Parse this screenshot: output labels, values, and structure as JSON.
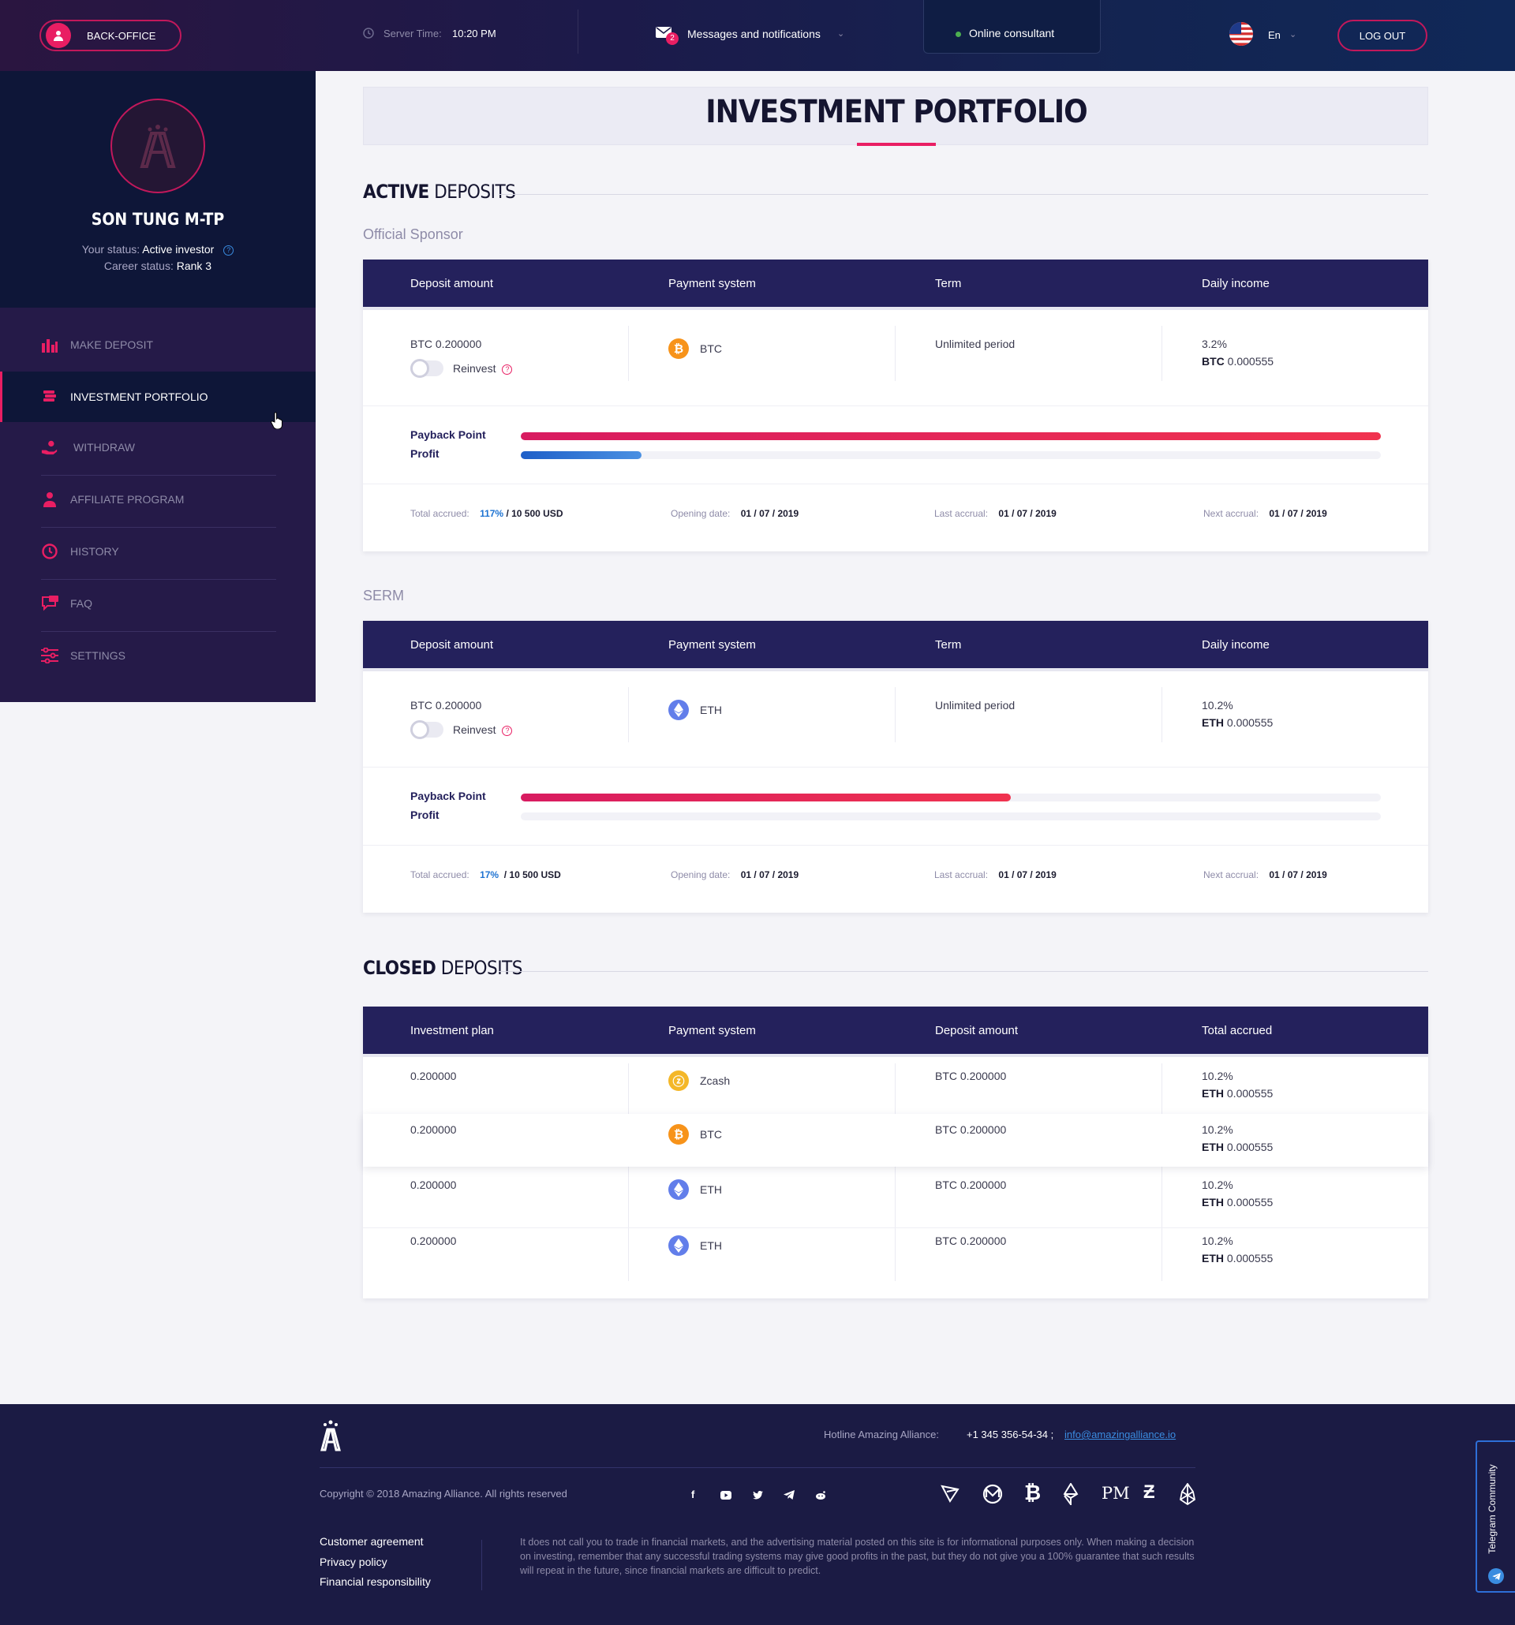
{
  "header": {
    "back_office": "BACK-OFFICE",
    "server_time_label": "Server Time:",
    "server_time": "10:20 PM",
    "messages_label": "Messages and notifications",
    "messages_count": "2",
    "online_consultant": "Online consultant",
    "language": "En",
    "logout": "LOG OUT"
  },
  "profile": {
    "name": "SON TUNG M-TP",
    "status_label": "Your status:",
    "status": "Active investor",
    "career_label": "Career status:",
    "career": "Rank 3"
  },
  "sidebar": {
    "items": [
      {
        "label": "MAKE DEPOSIT",
        "icon": "bar-chart-icon"
      },
      {
        "label": "INVESTMENT PORTFOLIO",
        "icon": "coins-icon"
      },
      {
        "label": "WITHDRAW",
        "icon": "hand-coin-icon"
      },
      {
        "label": "AFFILIATE PROGRAM",
        "icon": "user-icon"
      },
      {
        "label": "HISTORY",
        "icon": "clock-icon"
      },
      {
        "label": "FAQ",
        "icon": "chat-icon"
      },
      {
        "label": "SETTINGS",
        "icon": "sliders-icon"
      }
    ]
  },
  "page": {
    "title": "INVESTMENT PORTFOLIO"
  },
  "active": {
    "title_bold": "ACTIVE",
    "title_rest": " DEPOSITS"
  },
  "columns": {
    "deposit_amount": "Deposit amount",
    "payment_system": "Payment system",
    "term": "Term",
    "daily_income": "Daily income"
  },
  "deposits": [
    {
      "group": "Official Sponsor",
      "amount": "BTC 0.200000",
      "reinvest": "Reinvest",
      "coin": "BTC",
      "term": "Unlimited period",
      "daily_pct": "3.2%",
      "daily_cur": "BTC",
      "daily_val": "0.000555",
      "payback_label": "Payback Point",
      "profit_label": "Profit",
      "payback_progress": 1.0,
      "profit_progress": 0.14,
      "total_label": "Total accrued:",
      "total_pct": "117%",
      "total_val": "/ 10 500 USD",
      "opening_label": "Opening date:",
      "opening": "01 / 07 / 2019",
      "last_label": "Last accrual:",
      "last": "01 / 07 / 2019",
      "next_label": "Next accrual:",
      "next": "01 / 07 / 2019"
    },
    {
      "group": "SERM",
      "amount": "BTC 0.200000",
      "reinvest": "Reinvest",
      "coin": "ETH",
      "term": "Unlimited period",
      "daily_pct": "10.2%",
      "daily_cur": "ETH",
      "daily_val": "0.000555",
      "payback_label": "Payback Point",
      "profit_label": "Profit",
      "payback_progress": 0.57,
      "profit_progress": 0,
      "total_label": "Total accrued:",
      "total_pct": "17%",
      "total_val": "/ 10 500 USD",
      "opening_label": "Opening date:",
      "opening": "01 / 07 / 2019",
      "last_label": "Last accrual:",
      "last": "01 / 07 / 2019",
      "next_label": "Next accrual:",
      "next": "01 / 07 / 2019"
    }
  ],
  "closed": {
    "title_bold": "CLOSED",
    "title_rest": " DEPOSITS",
    "columns": {
      "plan": "Investment plan",
      "payment": "Payment system",
      "amount": "Deposit amount",
      "total": "Total accrued"
    },
    "rows": [
      {
        "plan": "0.200000",
        "coin": "Zcash",
        "amount": "BTC 0.200000",
        "pct": "10.2%",
        "cur": "ETH",
        "val": "0.000555"
      },
      {
        "plan": "0.200000",
        "coin": "BTC",
        "amount": "BTC 0.200000",
        "pct": "10.2%",
        "cur": "ETH",
        "val": "0.000555"
      },
      {
        "plan": "0.200000",
        "coin": "ETH",
        "amount": "BTC 0.200000",
        "pct": "10.2%",
        "cur": "ETH",
        "val": "0.000555"
      },
      {
        "plan": "0.200000",
        "coin": "ETH",
        "amount": "BTC 0.200000",
        "pct": "10.2%",
        "cur": "ETH",
        "val": "0.000555"
      }
    ]
  },
  "footer": {
    "hotline_label": "Hotline Amazing Alliance:",
    "phone": "+1 345 356-54-34 ;",
    "email": "info@amazingalliance.io",
    "copyright": "Copyright © 2018 Amazing Alliance. All rights reserved",
    "links": [
      "Customer agreement",
      "Privacy policy",
      "Financial responsibility"
    ],
    "disclaimer": "It does not call you to trade in financial markets, and the advertising material posted on this site is for informational purposes only. When making a decision on investing, remember that any successful trading systems may give good profits in the past, but they do not give you a 100% guarantee that such results will repeat in the future, since financial markets are difficult to predict.",
    "pm": "PM",
    "telegram": "Telegram Community"
  },
  "colors": {
    "accent": "#e91e63",
    "navy": "#24215c",
    "btc": "#f7931a",
    "eth": "#627eea",
    "zcash": "#f4b728",
    "progress_blue": "#1e73d2"
  }
}
